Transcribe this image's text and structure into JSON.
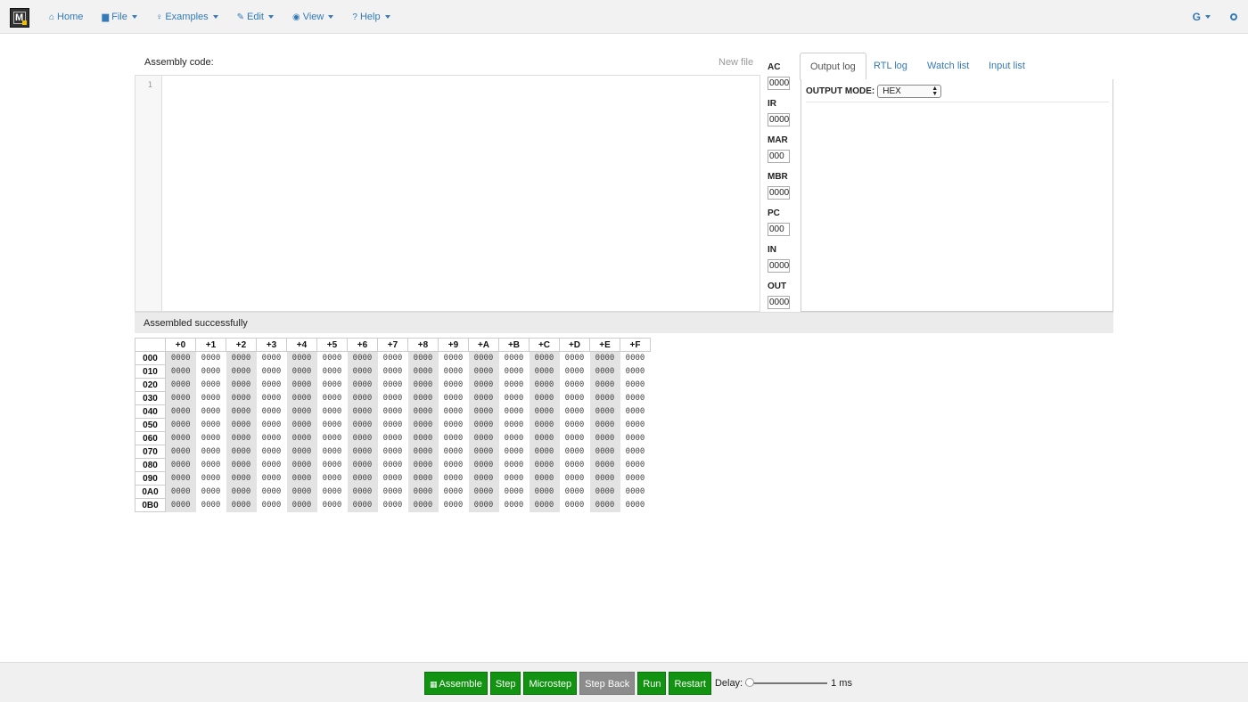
{
  "nav": {
    "items": [
      {
        "label": "Home",
        "icon": "home-icon",
        "glyph": "⌂",
        "dropdown": false
      },
      {
        "label": "File",
        "icon": "file-icon",
        "glyph": "▆",
        "dropdown": true
      },
      {
        "label": "Examples",
        "icon": "lightbulb-icon",
        "glyph": "♀",
        "dropdown": true
      },
      {
        "label": "Edit",
        "icon": "pencil-icon",
        "glyph": "✎",
        "dropdown": true
      },
      {
        "label": "View",
        "icon": "eye-icon",
        "glyph": "◉",
        "dropdown": true
      },
      {
        "label": "Help",
        "icon": "question-icon",
        "glyph": "?",
        "dropdown": true
      }
    ],
    "google_label": "G",
    "github_icon": "github-icon"
  },
  "editor": {
    "label": "Assembly code:",
    "new_file": "New file",
    "line_number": "1"
  },
  "registers": [
    {
      "name": "AC",
      "value": "0000"
    },
    {
      "name": "IR",
      "value": "0000"
    },
    {
      "name": "MAR",
      "value": "000"
    },
    {
      "name": "MBR",
      "value": "0000"
    },
    {
      "name": "PC",
      "value": "000"
    },
    {
      "name": "IN",
      "value": "0000"
    },
    {
      "name": "OUT",
      "value": "0000"
    }
  ],
  "tabs": [
    {
      "label": "Output log",
      "active": true
    },
    {
      "label": "RTL log",
      "active": false
    },
    {
      "label": "Watch list",
      "active": false
    },
    {
      "label": "Input list",
      "active": false
    }
  ],
  "output": {
    "mode_label": "OUTPUT MODE:",
    "mode_value": "HEX"
  },
  "status": "Assembled successfully",
  "memory": {
    "columns": [
      "+0",
      "+1",
      "+2",
      "+3",
      "+4",
      "+5",
      "+6",
      "+7",
      "+8",
      "+9",
      "+A",
      "+B",
      "+C",
      "+D",
      "+E",
      "+F"
    ],
    "rows": [
      "000",
      "010",
      "020",
      "030",
      "040",
      "050",
      "060",
      "070",
      "080",
      "090",
      "0A0",
      "0B0"
    ],
    "cell_value": "0000"
  },
  "controls": {
    "buttons": [
      {
        "label": "Assemble",
        "disabled": false,
        "icon": "grid-icon"
      },
      {
        "label": "Step",
        "disabled": false
      },
      {
        "label": "Microstep",
        "disabled": false
      },
      {
        "label": "Step Back",
        "disabled": true
      },
      {
        "label": "Run",
        "disabled": false
      },
      {
        "label": "Restart",
        "disabled": false
      }
    ],
    "delay_label": "Delay:",
    "delay_value": "1 ms",
    "delay_fraction": 0.0
  },
  "colors": {
    "accent": "#337ab7",
    "button_green": "#129412",
    "button_disabled": "#8c8c8c"
  }
}
